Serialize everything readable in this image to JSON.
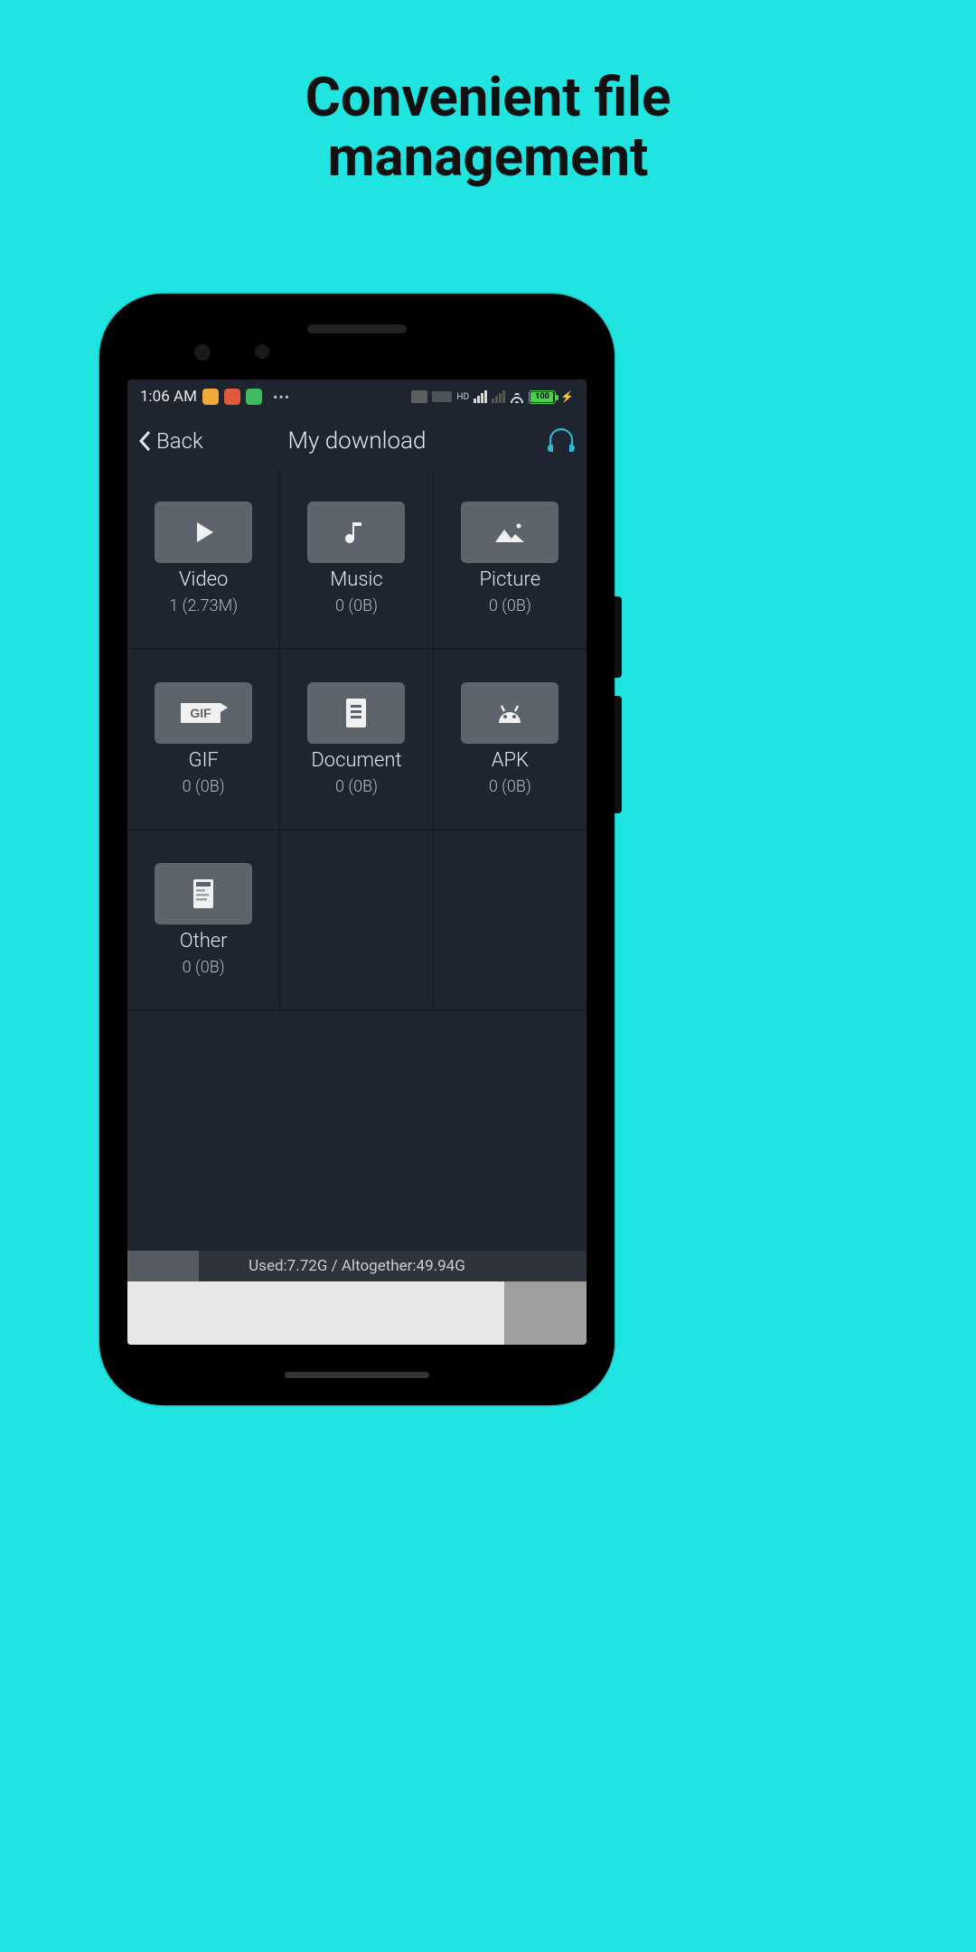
{
  "promo_headline_l1": "Convenient file",
  "promo_headline_l2": "management",
  "statusbar": {
    "time": "1:06 AM",
    "battery_text": "100"
  },
  "nav": {
    "back_label": "Back",
    "title": "My download"
  },
  "categories": [
    {
      "name": "Video",
      "info": "1 (2.73M)",
      "icon": "play"
    },
    {
      "name": "Music",
      "info": "0 (0B)",
      "icon": "music"
    },
    {
      "name": "Picture",
      "info": "0 (0B)",
      "icon": "picture"
    },
    {
      "name": "GIF",
      "info": "0 (0B)",
      "icon": "gif"
    },
    {
      "name": "Document",
      "info": "0 (0B)",
      "icon": "document"
    },
    {
      "name": "APK",
      "info": "0 (0B)",
      "icon": "apk"
    },
    {
      "name": "Other",
      "info": "0 (0B)",
      "icon": "other"
    }
  ],
  "storage": {
    "text": "Used:7.72G / Altogether:49.94G",
    "used": "7.72G",
    "total": "49.94G",
    "percent": 15.5
  }
}
